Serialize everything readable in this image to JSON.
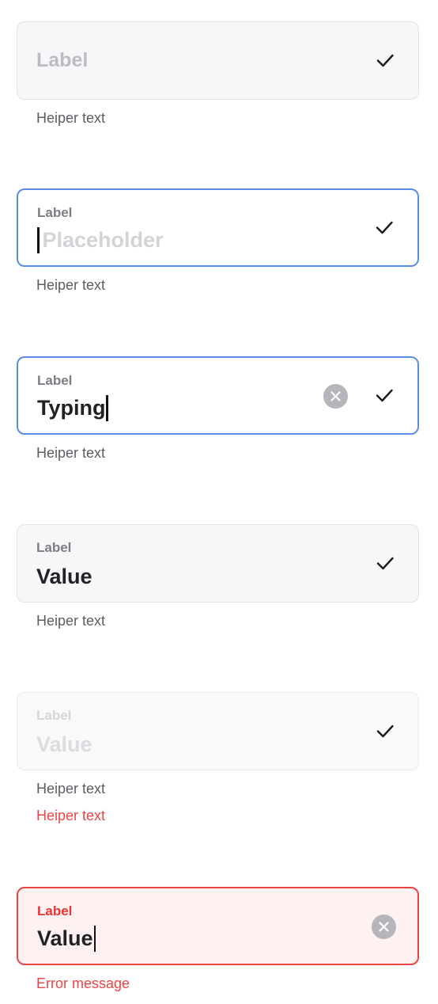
{
  "fields": [
    {
      "state": "default",
      "label": "Label",
      "helper": "Heiper text"
    },
    {
      "state": "focused-empty",
      "label": "Label",
      "placeholder": "Placeholder",
      "helper": "Heiper text"
    },
    {
      "state": "typing",
      "label": "Label",
      "value": "Typing",
      "helper": "Heiper text"
    },
    {
      "state": "filled",
      "label": "Label",
      "value": "Value",
      "helper": "Heiper text"
    },
    {
      "state": "disabled",
      "label": "Label",
      "value": "Value",
      "helper": "Heiper text",
      "helper_error": "Heiper text"
    },
    {
      "state": "error",
      "label": "Label",
      "value": "Value",
      "error_message": "Error message"
    }
  ],
  "colors": {
    "focus_border": "#5b8de8",
    "error": "#ee4444",
    "field_bg": "#f7f7f9",
    "error_bg": "#fdf2f1"
  },
  "icons": {
    "confirm": "check-icon",
    "clear": "clear-x-icon"
  }
}
